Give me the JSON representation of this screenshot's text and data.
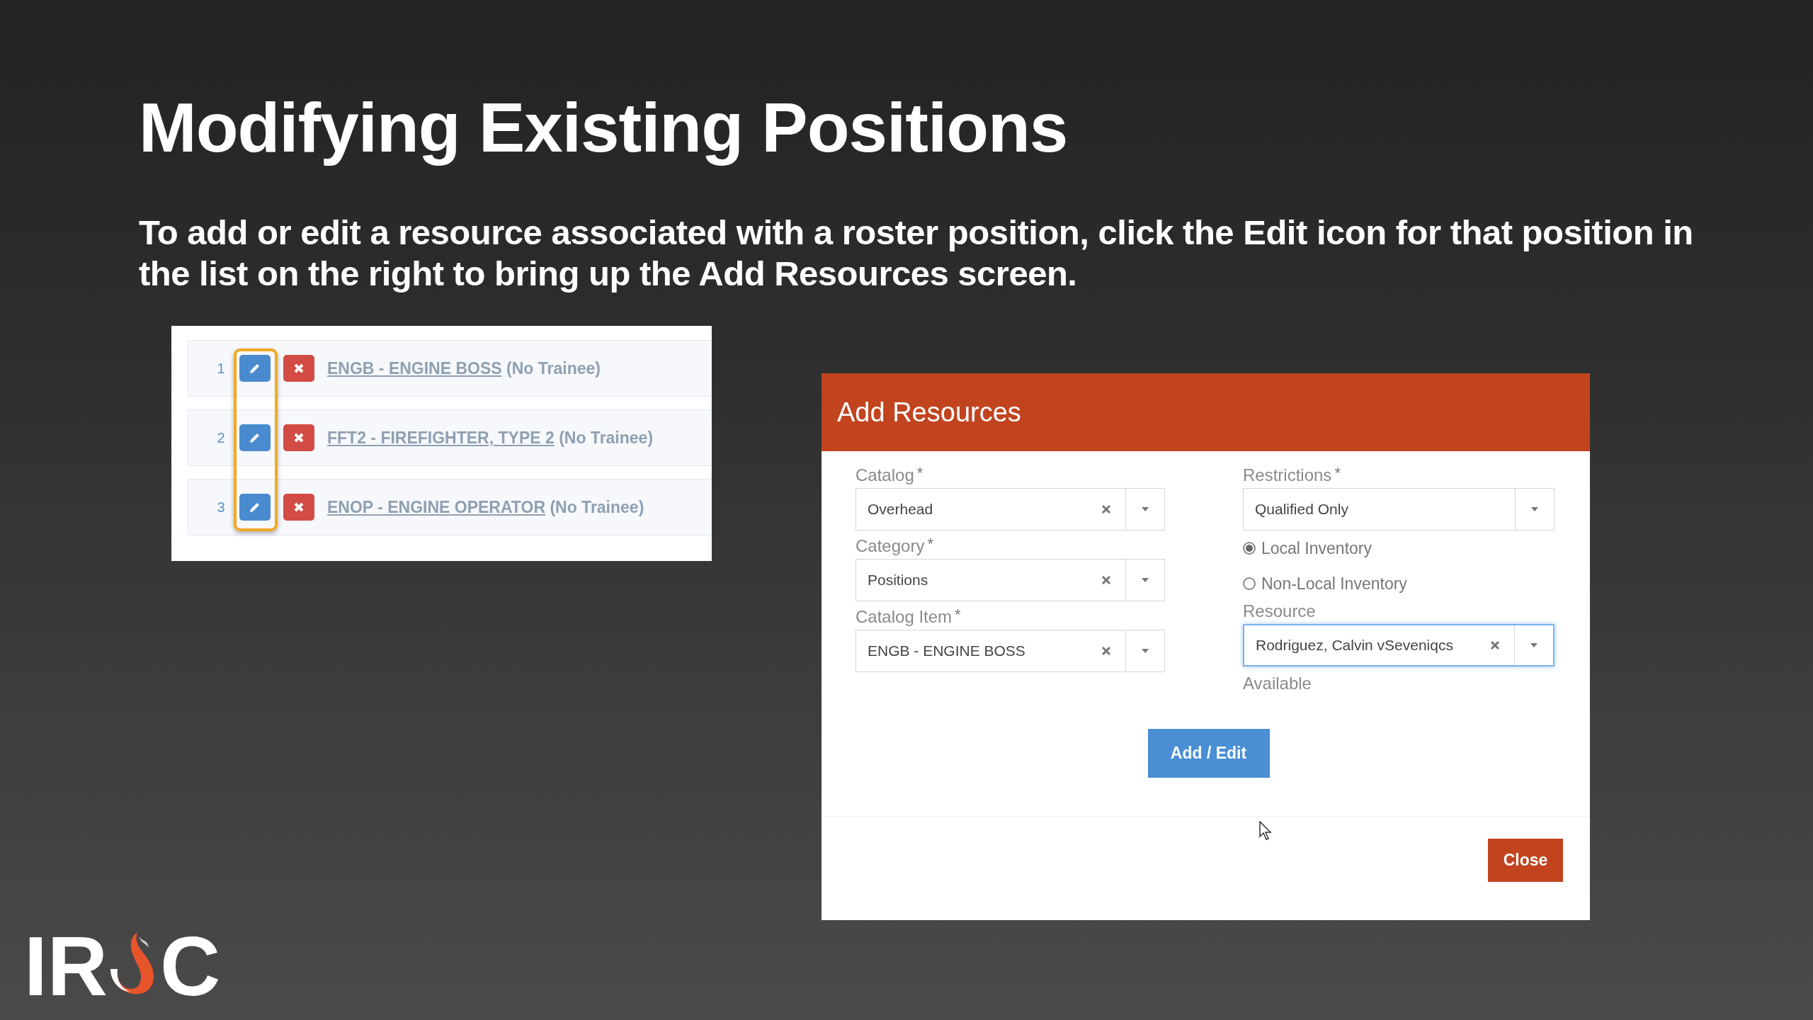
{
  "slide": {
    "title": "Modifying Existing Positions",
    "body": "To add or edit a resource associated with a roster position, click the Edit icon for that position in the list on the right to bring up the Add Resources screen."
  },
  "roster": {
    "highlight_edit_column": true,
    "rows": [
      {
        "number": "1",
        "position": "ENGB - ENGINE BOSS",
        "trainee": "(No Trainee)"
      },
      {
        "number": "2",
        "position": "FFT2 - FIREFIGHTER, TYPE 2",
        "trainee": "(No Trainee)"
      },
      {
        "number": "3",
        "position": "ENOP - ENGINE OPERATOR",
        "trainee": "(No Trainee)"
      }
    ]
  },
  "dialog": {
    "title": "Add Resources",
    "left_fields": [
      {
        "label": "Catalog",
        "required_mark": "*",
        "value": "Overhead",
        "clearable": true,
        "focused": false
      },
      {
        "label": "Category",
        "required_mark": "*",
        "value": "Positions",
        "clearable": true,
        "focused": false
      },
      {
        "label": "Catalog Item",
        "required_mark": "*",
        "value": "ENGB - ENGINE BOSS",
        "clearable": true,
        "focused": false
      }
    ],
    "restrictions": {
      "label": "Restrictions",
      "required_mark": "*",
      "value": "Qualified Only",
      "clearable": false,
      "focused": false
    },
    "inventory_options": [
      {
        "label": "Local Inventory",
        "selected": true
      },
      {
        "label": "Non-Local Inventory",
        "selected": false
      }
    ],
    "resource": {
      "label": "Resource",
      "value": "Rodriguez, Calvin vSeveniqcs",
      "clearable": true,
      "focused": true,
      "status": "Available"
    },
    "add_button": "Add / Edit",
    "close_button": "Close"
  },
  "logo": {
    "before": "IR",
    "after": "C"
  }
}
